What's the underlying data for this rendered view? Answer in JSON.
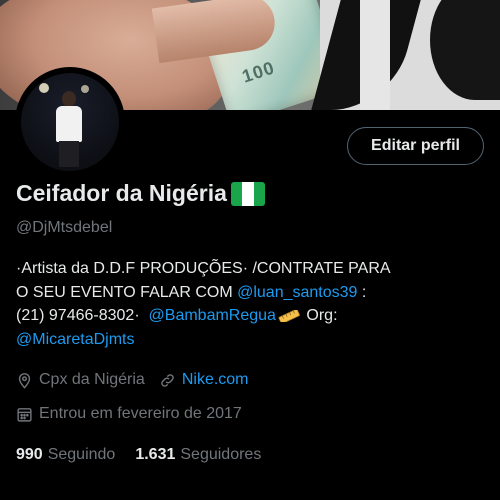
{
  "banner": {
    "cash_text": "100"
  },
  "profile": {
    "edit_button": "Editar perfil",
    "display_name": "Ceifador da Nigéria",
    "handle": "@DjMtsdebel",
    "bio": {
      "line1": "·Artista da D.D.F PRODUÇÕES· /CONTRATE PARA",
      "line2_text": "O SEU EVENTO FALAR COM ",
      "line2_mention": "@luan_santos39",
      "line2_tail": " :",
      "line3_text": "(21) 97466-8302·  ",
      "line3_mention": "@BambamRegua",
      "line3_tail": " Org:",
      "line4_mention": "@MicaretaDjmts"
    },
    "location": "Cpx da Nigéria",
    "website": "Nike.com",
    "joined": "Entrou em fevereiro de 2017",
    "following_count": "990",
    "following_label": "Seguindo",
    "followers_count": "1.631",
    "followers_label": "Seguidores"
  },
  "colors": {
    "background": "#000000",
    "text": "#e7e9ea",
    "secondary_text": "#71767b",
    "link": "#1d9bf0",
    "button_border": "#536471",
    "flag_green": "#1aa54a"
  },
  "icons": [
    "nigeria-flag-icon",
    "ruler-icon",
    "location-icon",
    "link-icon",
    "calendar-icon"
  ]
}
